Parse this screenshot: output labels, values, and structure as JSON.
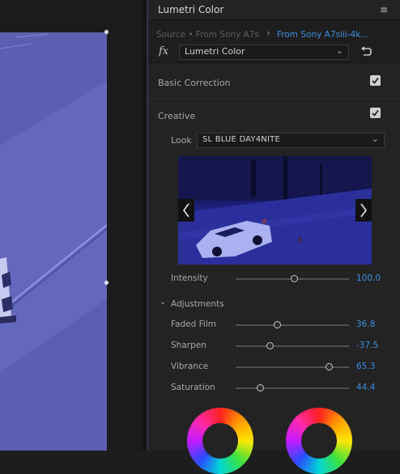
{
  "panel": {
    "title": "Lumetri Color",
    "menu_icon": "hamburger-menu-icon",
    "source_master": "Source • From Sony A7si…",
    "source_clip": "From Sony A7siii-4k…",
    "fx_label": "fx",
    "effect_name": "Lumetri Color"
  },
  "sections": {
    "basic_correction": {
      "label": "Basic Correction",
      "checked": true
    },
    "creative": {
      "label": "Creative",
      "checked": true
    }
  },
  "creative": {
    "look_label": "Look",
    "look_value": "SL BLUE DAY4NITE",
    "intensity": {
      "label": "Intensity",
      "value": "100.0",
      "fraction": 0.52
    },
    "adjustments_label": "Adjustments",
    "sliders": [
      {
        "label": "Faded Film",
        "value": "36.8",
        "fraction": 0.37
      },
      {
        "label": "Sharpen",
        "value": "-37.5",
        "fraction": 0.31
      },
      {
        "label": "Vibrance",
        "value": "65.3",
        "fraction": 0.83
      },
      {
        "label": "Saturation",
        "value": "44.4",
        "fraction": 0.22
      }
    ]
  },
  "colors": {
    "accent_blue": "#3d8ee0",
    "panel_bg": "#232323",
    "video_tint": "#5a5fb0"
  }
}
